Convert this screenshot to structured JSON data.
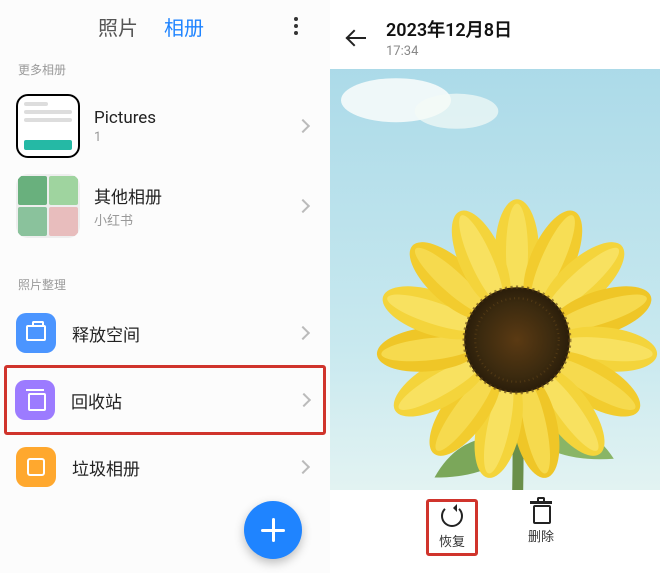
{
  "left": {
    "tabs": {
      "photos": "照片",
      "albums": "相册"
    },
    "sections": {
      "more_albums_label": "更多相册",
      "photo_manage_label": "照片整理"
    },
    "albums": [
      {
        "title": "Pictures",
        "subtitle": "1"
      },
      {
        "title": "其他相册",
        "subtitle": "小红书"
      }
    ],
    "manage": {
      "free_space": "释放空间",
      "recycle_bin": "回收站",
      "junk_album": "垃圾相册"
    },
    "colors": {
      "free_space": "#4b95ff",
      "recycle_bin": "#9c7bff",
      "junk_album": "#ffa82e"
    }
  },
  "right": {
    "date": "2023年12月8日",
    "time": "17:34",
    "actions": {
      "restore": "恢复",
      "delete": "删除"
    }
  }
}
